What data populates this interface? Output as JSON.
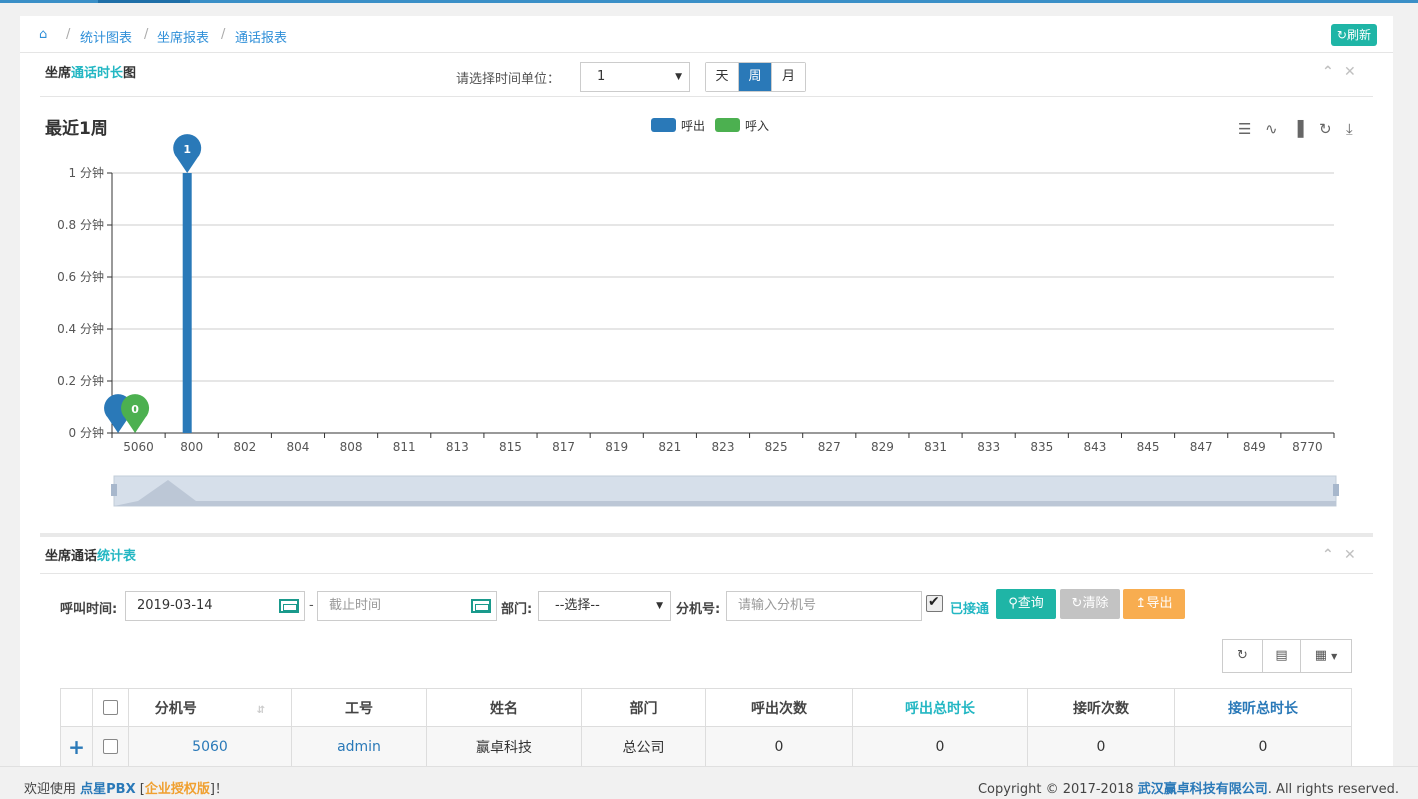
{
  "breadcrumb": {
    "items": [
      "统计图表",
      "坐席报表",
      "通话报表"
    ]
  },
  "refresh_label": "刷新",
  "chart_panel": {
    "title_pre": "坐席",
    "title_hl": "通话时长",
    "title_post": "图",
    "time_unit_label": "请选择时间单位：",
    "time_unit_value": "1",
    "segments": [
      "天",
      "周",
      "月"
    ],
    "active_segment": "周"
  },
  "chart_data": {
    "type": "bar",
    "title": "最近1周",
    "legend": [
      "呼出",
      "呼入"
    ],
    "legend_position": "top-center",
    "categories": [
      "5060",
      "800",
      "802",
      "804",
      "808",
      "811",
      "813",
      "815",
      "817",
      "819",
      "821",
      "823",
      "825",
      "827",
      "829",
      "831",
      "833",
      "835",
      "843",
      "845",
      "847",
      "849",
      "8770"
    ],
    "series": [
      {
        "name": "呼出",
        "values": [
          0,
          1,
          0,
          0,
          0,
          0,
          0,
          0,
          0,
          0,
          0,
          0,
          0,
          0,
          0,
          0,
          0,
          0,
          0,
          0,
          0,
          0,
          0
        ]
      },
      {
        "name": "呼入",
        "values": [
          0,
          0,
          0,
          0,
          0,
          0,
          0,
          0,
          0,
          0,
          0,
          0,
          0,
          0,
          0,
          0,
          0,
          0,
          0,
          0,
          0,
          0,
          0
        ]
      }
    ],
    "ytick_labels": [
      "0 分钟",
      "0.2 分钟",
      "0.4 分钟",
      "0.6 分钟",
      "0.8 分钟",
      "1 分钟"
    ],
    "ylim": [
      0,
      1
    ],
    "markers": [
      {
        "series": "呼出",
        "category": "800",
        "label": "1"
      },
      {
        "series": "呼出",
        "category": "5060",
        "label": ""
      },
      {
        "series": "呼入",
        "category": "5060",
        "label": "0"
      }
    ],
    "grid": true,
    "colors": {
      "呼出": "#2a79b8",
      "呼入": "#4cb050"
    },
    "toolbox_icons": [
      "data-view-icon",
      "line-chart-icon",
      "bar-chart-icon",
      "restore-icon",
      "download-icon"
    ]
  },
  "table_panel": {
    "title_pre": "坐席通话",
    "title_hl": "统计表"
  },
  "filters": {
    "call_time_label": "呼叫时间:",
    "start_date": "2019-03-14",
    "dash": "-",
    "end_placeholder": "截止时间",
    "dept_label": "部门:",
    "dept_value": "--选择--",
    "ext_label": "分机号:",
    "ext_placeholder": "请输入分机号",
    "connected_label": "已接通",
    "query_label": "查询",
    "clear_label": "清除",
    "export_label": "导出"
  },
  "table": {
    "headers": [
      "分机号",
      "工号",
      "姓名",
      "部门",
      "呼出次数",
      "呼出总时长",
      "接听次数",
      "接听总时长"
    ],
    "rows": [
      [
        "5060",
        "admin",
        "赢卓科技",
        "总公司",
        "0",
        "0",
        "0",
        "0"
      ]
    ]
  },
  "footer": {
    "welcome": "欢迎使用 ",
    "product": "点星PBX",
    "bracket_open": " [",
    "edition": "企业授权版",
    "bracket_close": "]！",
    "copyright_pre": "Copyright © 2017-2018 ",
    "company": "武汉赢卓科技有限公司",
    "copyright_post": ". All rights reserved."
  }
}
